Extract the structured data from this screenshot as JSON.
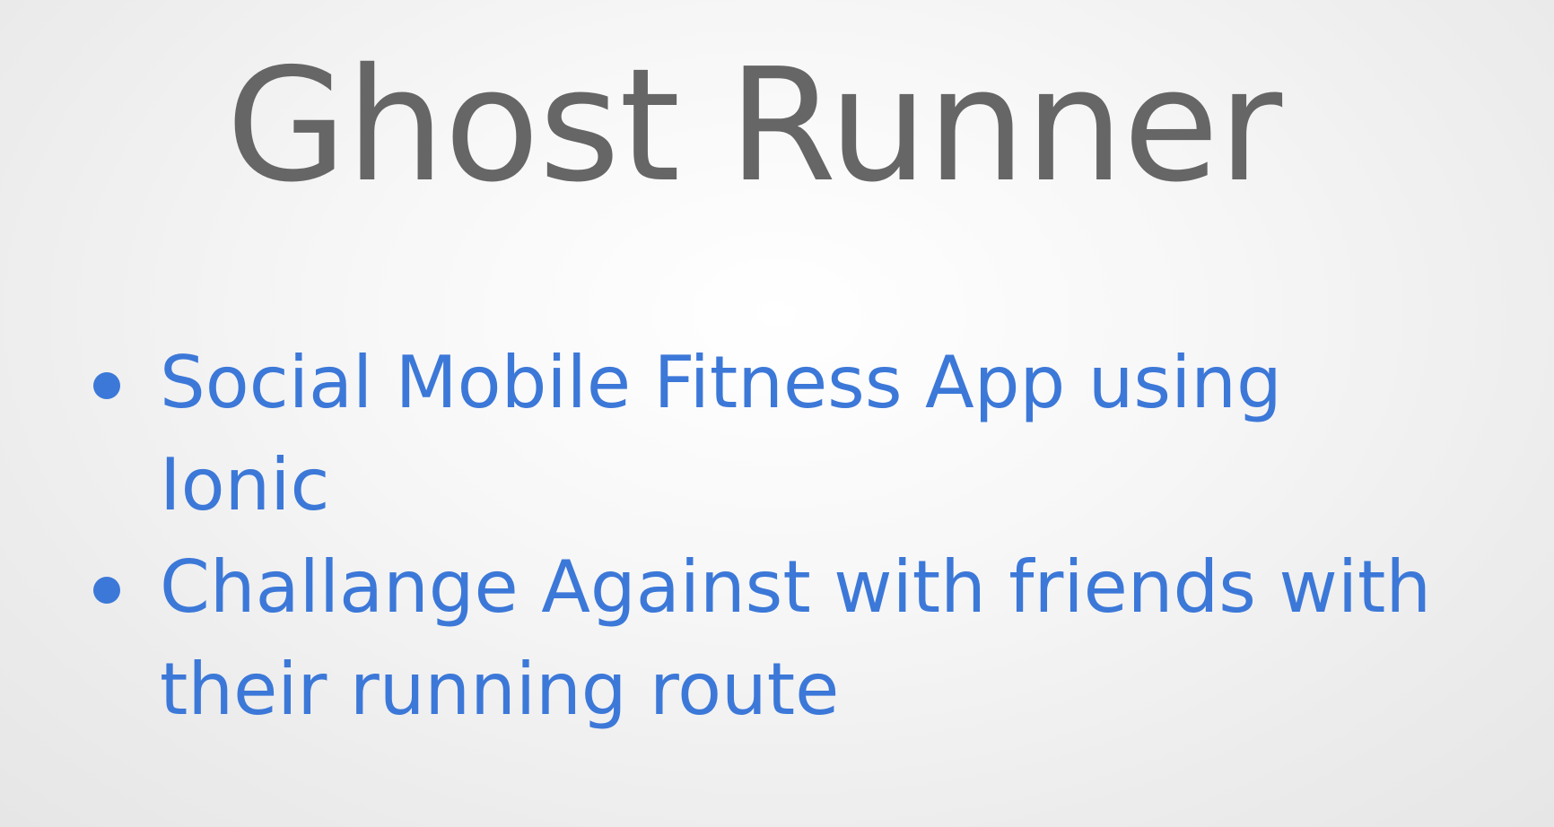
{
  "slide": {
    "title": "Ghost Runner",
    "bullets": [
      {
        "lines": [
          "Social Mobile Fitness App using",
          "Ionic"
        ]
      },
      {
        "lines": [
          "Challange Against with friends with",
          "their running route"
        ]
      }
    ]
  },
  "colors": {
    "title": "#666666",
    "bullet_text": "#3c78d8",
    "background": "#f2f2f2"
  }
}
